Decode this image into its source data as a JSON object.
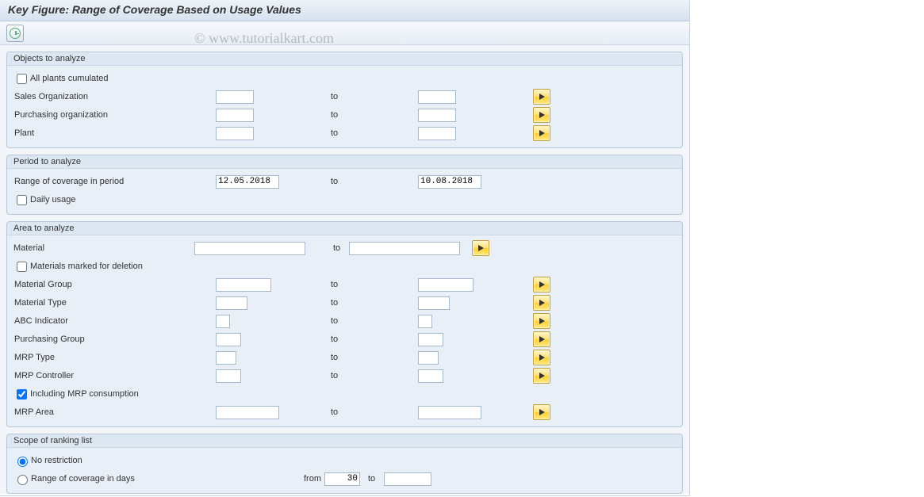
{
  "title": "Key Figure: Range of Coverage Based on Usage Values",
  "watermark": "© www.tutorialkart.com",
  "groups": {
    "objects": {
      "title": "Objects to analyze",
      "all_plants_label": "All plants cumulated",
      "sales_org_label": "Sales Organization",
      "purch_org_label": "Purchasing organization",
      "plant_label": "Plant",
      "to": "to"
    },
    "period": {
      "title": "Period to analyze",
      "range_label": "Range of coverage in period",
      "from_value": "12.05.2018",
      "to_value": "10.08.2018",
      "to": "to",
      "daily_label": "Daily usage"
    },
    "area": {
      "title": "Area to analyze",
      "material_label": "Material",
      "to": "to",
      "deletion_label": "Materials marked for deletion",
      "matgroup_label": "Material Group",
      "mattype_label": "Material Type",
      "abc_label": "ABC Indicator",
      "purchgroup_label": "Purchasing Group",
      "mrptype_label": "MRP Type",
      "mrpctrl_label": "MRP Controller",
      "incl_mrp_label": "Including MRP consumption",
      "mrparea_label": "MRP Area"
    },
    "scope": {
      "title": "Scope of ranking list",
      "no_restrict_label": "No restriction",
      "range_days_label": "Range of coverage in days",
      "from": "from",
      "from_value": "30",
      "to": "to"
    }
  }
}
